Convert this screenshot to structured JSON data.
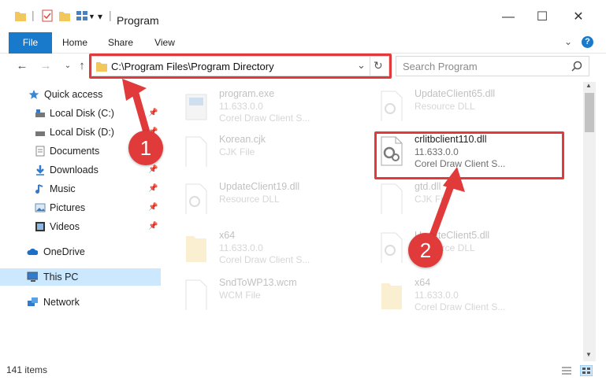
{
  "window": {
    "title": "Program"
  },
  "ribbon": {
    "tabs": [
      "File",
      "Home",
      "Share",
      "View"
    ]
  },
  "address": {
    "path": "C:\\Program Files\\Program Directory"
  },
  "search": {
    "placeholder": "Search Program"
  },
  "sidebar": {
    "items": [
      {
        "label": "Quick access",
        "icon": "star-icon"
      },
      {
        "label": "Local Disk (C:)",
        "icon": "drive-icon",
        "pinned": true
      },
      {
        "label": "Local Disk (D:)",
        "icon": "drive-icon",
        "pinned": true
      },
      {
        "label": "Documents",
        "icon": "documents-icon",
        "pinned": true
      },
      {
        "label": "Downloads",
        "icon": "download-icon",
        "pinned": true
      },
      {
        "label": "Music",
        "icon": "music-icon",
        "pinned": true
      },
      {
        "label": "Pictures",
        "icon": "pictures-icon",
        "pinned": true
      },
      {
        "label": "Videos",
        "icon": "videos-icon",
        "pinned": true
      },
      {
        "label": "OneDrive",
        "icon": "cloud-icon"
      },
      {
        "label": "This PC",
        "icon": "computer-icon",
        "selected": true
      },
      {
        "label": "Network",
        "icon": "network-icon"
      }
    ]
  },
  "files": [
    {
      "name": "program.exe",
      "line1": "11.633.0.0",
      "line2": "Corel Draw Client S...",
      "icon": "exe-icon"
    },
    {
      "name": "UpdateClient65.dll",
      "line1": "Resource DLL",
      "line2": "",
      "icon": "dll-icon"
    },
    {
      "name": "Korean.cjk",
      "line1": "CJK File",
      "line2": "",
      "icon": "blank-file-icon"
    },
    {
      "name": "crlitbclient110.dll",
      "line1": "11.633.0.0",
      "line2": "Corel Draw Client S...",
      "icon": "dll-icon",
      "highlighted": true
    },
    {
      "name": "UpdateClient19.dll",
      "line1": "Resource DLL",
      "line2": "",
      "icon": "dll-icon"
    },
    {
      "name": "gtd.dll",
      "line1": "CJK File",
      "line2": "",
      "icon": "blank-file-icon"
    },
    {
      "name": "x64",
      "line1": "11.633.0.0",
      "line2": "Corel Draw Client S...",
      "icon": "folder-zip-icon"
    },
    {
      "name": "UpdateClient5.dll",
      "line1": "Resource DLL",
      "line2": "",
      "icon": "dll-icon"
    },
    {
      "name": "SndToWP13.wcm",
      "line1": "WCM File",
      "line2": "",
      "icon": "blank-file-icon"
    },
    {
      "name": "x64",
      "line1": "11.633.0.0",
      "line2": "Corel Draw Client S...",
      "icon": "folder-zip-icon"
    }
  ],
  "status": {
    "items_count": "141 items"
  },
  "annotations": {
    "step1": "1",
    "step2": "2"
  },
  "colors": {
    "accent": "#1979ca",
    "highlight": "#e03a3a",
    "selection": "#cce8ff"
  }
}
